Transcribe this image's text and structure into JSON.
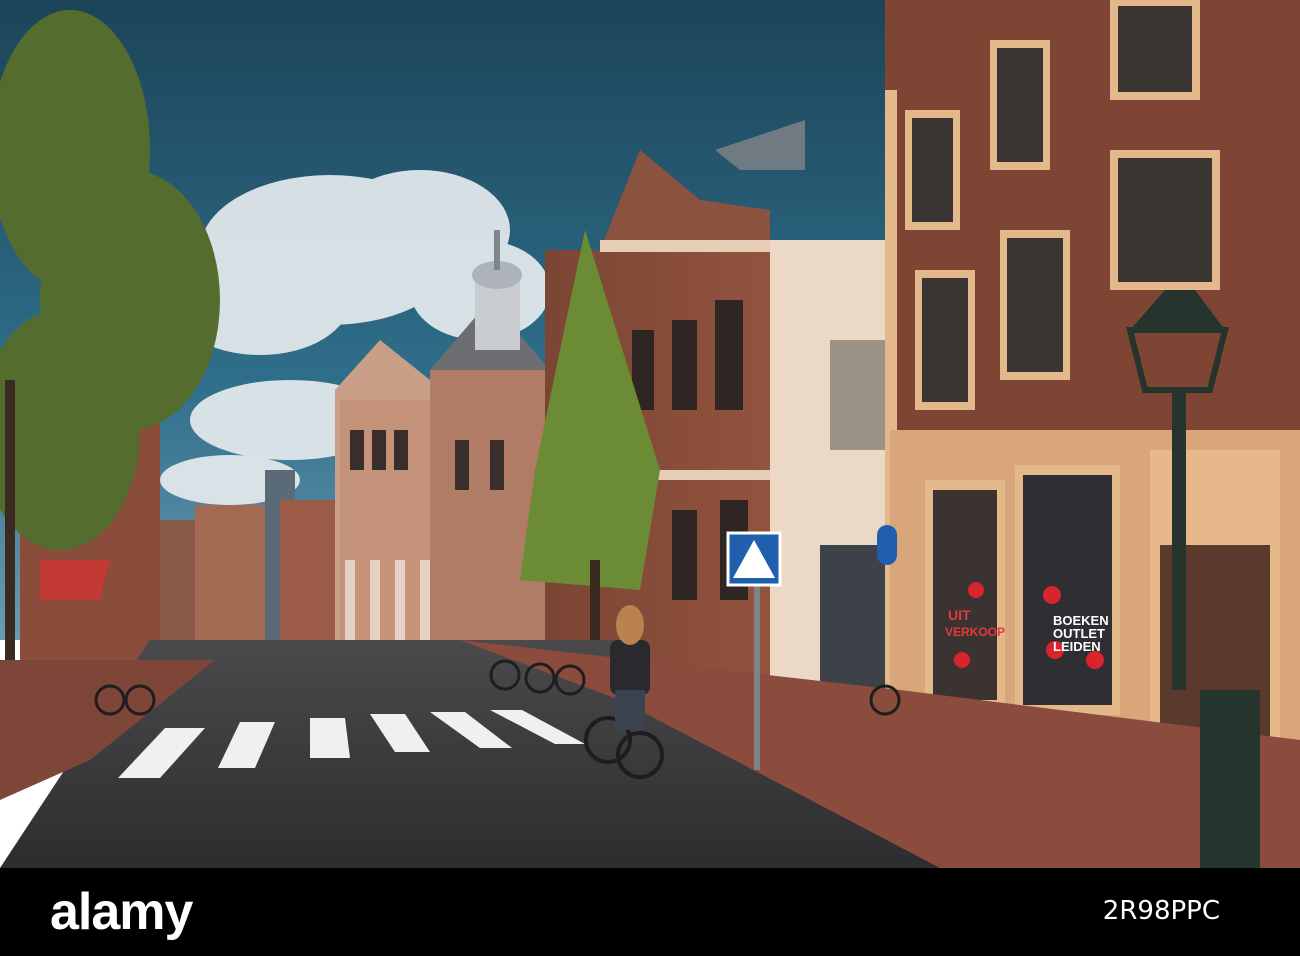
{
  "photo": {
    "subject": "street-scene",
    "colors": {
      "sky_top": "#1f4d63",
      "sky_mid": "#2e6f8a",
      "cloud": "#e9edf0",
      "brick": "#8a4f3e",
      "brick_dark": "#6e3c30",
      "window_frame": "#e3b98c",
      "road": "#3c3c3e",
      "sidewalk": "#8c4e40",
      "tree": "#5e7a33",
      "lamp": "#2a3a33"
    },
    "signs": {
      "shop_line1": "BOEKEN",
      "shop_line2": "OUTLET",
      "shop_line3": "LEIDEN",
      "sale_line1": "UIT",
      "sale_line2": "VERKOOP"
    }
  },
  "footer": {
    "brand": "alamy",
    "image_id": "2R98PPC"
  }
}
